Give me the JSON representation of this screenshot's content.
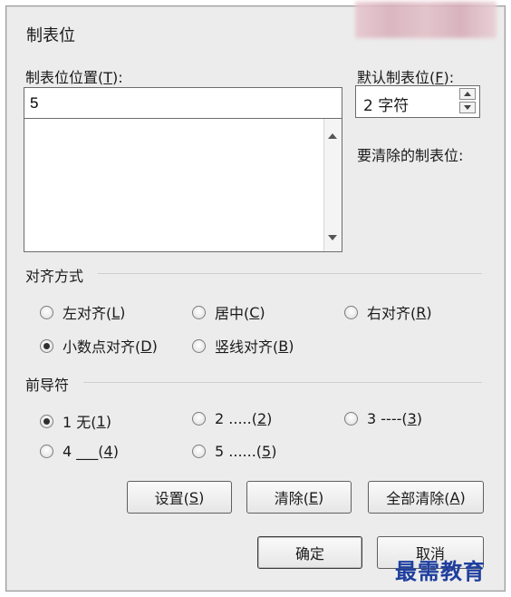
{
  "dialog": {
    "title": "制表位"
  },
  "tab_stop_position": {
    "label_prefix": "制表位位置(",
    "label_key": "T",
    "label_suffix": "):",
    "value": "5",
    "list_items": []
  },
  "default_tab_stops": {
    "label_prefix": "默认制表位(",
    "label_key": "F",
    "label_suffix": "):",
    "value": "2 字符"
  },
  "tab_stops_to_clear": {
    "label": "要清除的制表位:"
  },
  "alignment": {
    "group_label": "对齐方式",
    "options": [
      {
        "text": "左对齐(",
        "key": "L",
        "end": ")",
        "selected": false
      },
      {
        "text": "居中(",
        "key": "C",
        "end": ")",
        "selected": false
      },
      {
        "text": "右对齐(",
        "key": "R",
        "end": ")",
        "selected": false
      },
      {
        "text": "小数点对齐(",
        "key": "D",
        "end": ")",
        "selected": true
      },
      {
        "text": "竖线对齐(",
        "key": "B",
        "end": ")",
        "selected": false
      }
    ]
  },
  "leader": {
    "group_label": "前导符",
    "options": [
      {
        "text": "1 无(",
        "key": "1",
        "end": ")",
        "selected": true
      },
      {
        "text": "2 .....(",
        "key": "2",
        "end": ")",
        "selected": false
      },
      {
        "text": "3 ----(",
        "key": "3",
        "end": ")",
        "selected": false
      },
      {
        "text": "4 ___(",
        "key": "4",
        "end": ")",
        "selected": false
      },
      {
        "text": "5 ......(",
        "key": "5",
        "end": ")",
        "selected": false
      }
    ]
  },
  "buttons": {
    "set": {
      "text": "设置(",
      "key": "S",
      "end": ")"
    },
    "clear": {
      "text": "清除(",
      "key": "E",
      "end": ")"
    },
    "clear_all": {
      "text": "全部清除(",
      "key": "A",
      "end": ")"
    },
    "ok": "确定",
    "cancel": "取消"
  },
  "watermark": "最需教育"
}
